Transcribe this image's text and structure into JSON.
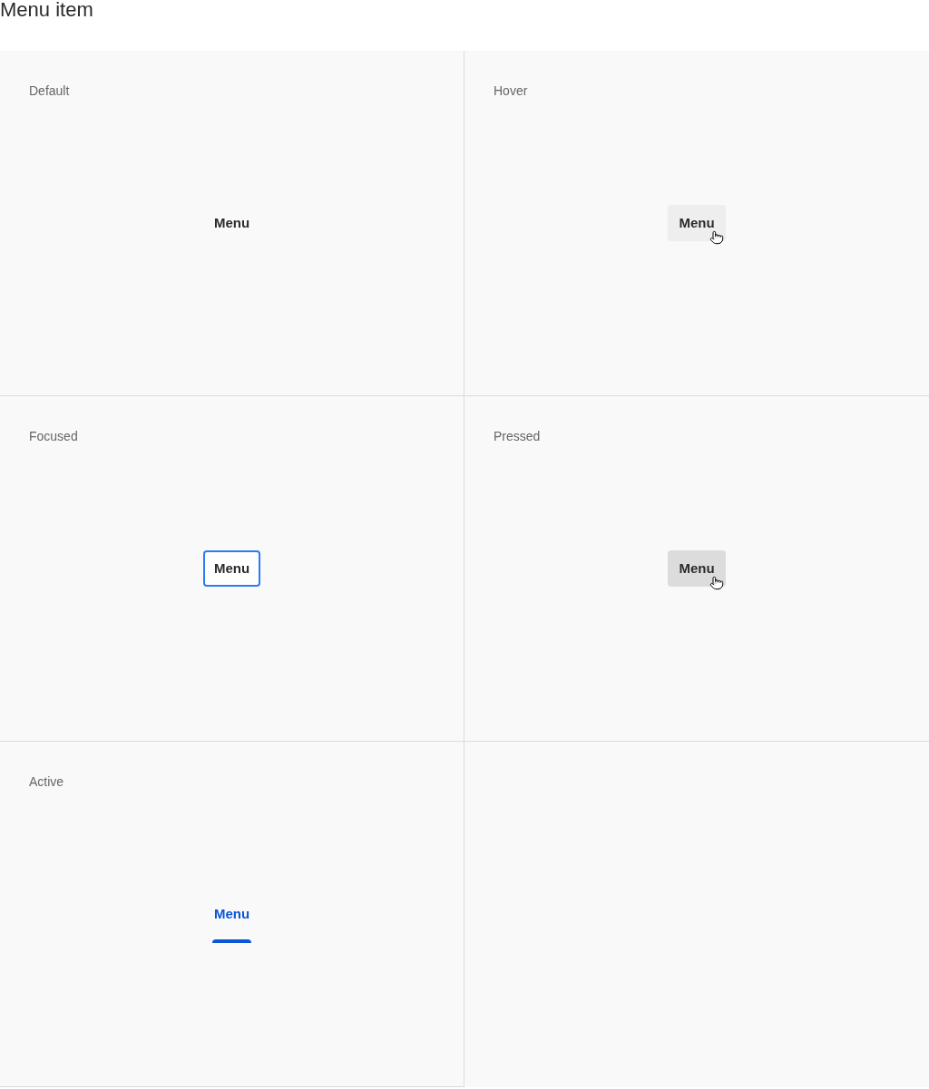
{
  "title": "Menu item",
  "states": [
    {
      "kind": "default",
      "label": "Default",
      "item": "Menu"
    },
    {
      "kind": "hover",
      "label": "Hover",
      "item": "Menu"
    },
    {
      "kind": "focused",
      "label": "Focused",
      "item": "Menu"
    },
    {
      "kind": "pressed",
      "label": "Pressed",
      "item": "Menu"
    },
    {
      "kind": "active",
      "label": "Active",
      "item": "Menu"
    }
  ]
}
